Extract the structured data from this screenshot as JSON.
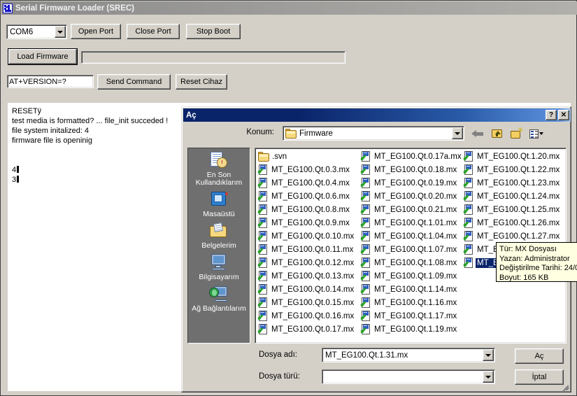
{
  "app": {
    "title": "Serial Firmware Loader (SREC)",
    "icon": "app-icon",
    "port_combo": {
      "value": "COM6"
    },
    "buttons": {
      "open_port": "Open Port",
      "close_port": "Close Port",
      "stop_boot": "Stop Boot",
      "load_firmware": "Load Firmware",
      "send_command": "Send Command",
      "reset_device": "Reset Cihaz"
    },
    "command_input": {
      "value": "AT+VERSION=?"
    },
    "progress": {
      "percent": 0
    },
    "log_lines": [
      "RESETÿ",
      "test media is formatted? ... file_init succeded !",
      "file system initalized: 4",
      "firmware file is openinig",
      "",
      "",
      "4",
      "3"
    ]
  },
  "dialog": {
    "title": "Aç",
    "help_button": "?",
    "close_button": "✕",
    "lookin_label": "Konum:",
    "lookin_value": "Firmware",
    "toolbar": [
      {
        "name": "back-icon",
        "label": "Geri"
      },
      {
        "name": "up-folder-icon",
        "label": "Bir Düzey Yukarı"
      },
      {
        "name": "new-folder-icon",
        "label": "Yeni Klasör Oluştur"
      },
      {
        "name": "views-icon",
        "label": "Görünümler"
      }
    ],
    "places": [
      {
        "name": "recent-documents",
        "label": "En Son Kullandıklarım",
        "icon": "recent-documents-icon"
      },
      {
        "name": "desktop",
        "label": "Masaüstü",
        "icon": "desktop-icon"
      },
      {
        "name": "my-documents",
        "label": "Belgelerim",
        "icon": "my-documents-icon"
      },
      {
        "name": "my-computer",
        "label": "Bilgisayarım",
        "icon": "my-computer-icon"
      },
      {
        "name": "my-network",
        "label": "Ağ Bağlantılarım",
        "icon": "network-icon"
      }
    ],
    "files": [
      {
        "name": ".svn",
        "type": "folder",
        "selected": false
      },
      {
        "name": "MT_EG100.Qt.0.3.mx",
        "type": "file",
        "selected": false
      },
      {
        "name": "MT_EG100.Qt.0.4.mx",
        "type": "file",
        "selected": false
      },
      {
        "name": "MT_EG100.Qt.0.6.mx",
        "type": "file",
        "selected": false
      },
      {
        "name": "MT_EG100.Qt.0.8.mx",
        "type": "file",
        "selected": false
      },
      {
        "name": "MT_EG100.Qt.0.9.mx",
        "type": "file",
        "selected": false
      },
      {
        "name": "MT_EG100.Qt.0.10.mx",
        "type": "file",
        "selected": false
      },
      {
        "name": "MT_EG100.Qt.0.11.mx",
        "type": "file",
        "selected": false
      },
      {
        "name": "MT_EG100.Qt.0.12.mx",
        "type": "file",
        "selected": false
      },
      {
        "name": "MT_EG100.Qt.0.13.mx",
        "type": "file",
        "selected": false
      },
      {
        "name": "MT_EG100.Qt.0.14.mx",
        "type": "file",
        "selected": false
      },
      {
        "name": "MT_EG100.Qt.0.15.mx",
        "type": "file",
        "selected": false
      },
      {
        "name": "MT_EG100.Qt.0.16.mx",
        "type": "file",
        "selected": false
      },
      {
        "name": "MT_EG100.Qt.0.17.mx",
        "type": "file",
        "selected": false
      },
      {
        "name": "MT_EG100.Qt.0.17a.mx",
        "type": "file",
        "selected": false
      },
      {
        "name": "MT_EG100.Qt.0.18.mx",
        "type": "file",
        "selected": false
      },
      {
        "name": "MT_EG100.Qt.0.19.mx",
        "type": "file",
        "selected": false
      },
      {
        "name": "MT_EG100.Qt.0.20.mx",
        "type": "file",
        "selected": false
      },
      {
        "name": "MT_EG100.Qt.0.21.mx",
        "type": "file",
        "selected": false
      },
      {
        "name": "MT_EG100.Qt.1.01.mx",
        "type": "file",
        "selected": false
      },
      {
        "name": "MT_EG100.Qt.1.04.mx",
        "type": "file",
        "selected": false
      },
      {
        "name": "MT_EG100.Qt.1.07.mx",
        "type": "file",
        "selected": false
      },
      {
        "name": "MT_EG100.Qt.1.08.mx",
        "type": "file",
        "selected": false
      },
      {
        "name": "MT_EG100.Qt.1.09.mx",
        "type": "file",
        "selected": false
      },
      {
        "name": "MT_EG100.Qt.1.14.mx",
        "type": "file",
        "selected": false
      },
      {
        "name": "MT_EG100.Qt.1.16.mx",
        "type": "file",
        "selected": false
      },
      {
        "name": "MT_EG100.Qt.1.17.mx",
        "type": "file",
        "selected": false
      },
      {
        "name": "MT_EG100.Qt.1.19.mx",
        "type": "file",
        "selected": false
      },
      {
        "name": "MT_EG100.Qt.1.20.mx",
        "type": "file",
        "selected": false
      },
      {
        "name": "MT_EG100.Qt.1.22.mx",
        "type": "file",
        "selected": false
      },
      {
        "name": "MT_EG100.Qt.1.23.mx",
        "type": "file",
        "selected": false
      },
      {
        "name": "MT_EG100.Qt.1.24.mx",
        "type": "file",
        "selected": false
      },
      {
        "name": "MT_EG100.Qt.1.25.mx",
        "type": "file",
        "selected": false
      },
      {
        "name": "MT_EG100.Qt.1.26.mx",
        "type": "file",
        "selected": false
      },
      {
        "name": "MT_EG100.Qt.1.27.mx",
        "type": "file",
        "selected": false
      },
      {
        "name": "MT_EG100.Qt.1.30.mx",
        "type": "file",
        "selected": false
      },
      {
        "name": "MT_EG100.Qt.1.31.mx",
        "type": "file",
        "selected": true
      }
    ],
    "filename_label": "Dosya adı:",
    "filename_value": "MT_EG100.Qt.1.31.mx",
    "filetype_label": "Dosya türü:",
    "filetype_value": "",
    "open_button": "Aç",
    "cancel_button": "İptal"
  },
  "tooltip": {
    "lines": [
      "Tür: MX Dosyası",
      "Yazan: Administrator",
      "Değiştirilme Tarihi: 24/0",
      "Boyut: 165 KB"
    ]
  },
  "colors": {
    "window_face": "#d4d0c8",
    "active_title": "#0a246a",
    "inactive_title": "#808080",
    "selection": "#0a246a",
    "tooltip_bg": "#ffffe1",
    "places_bar": "#6f6f6f"
  }
}
